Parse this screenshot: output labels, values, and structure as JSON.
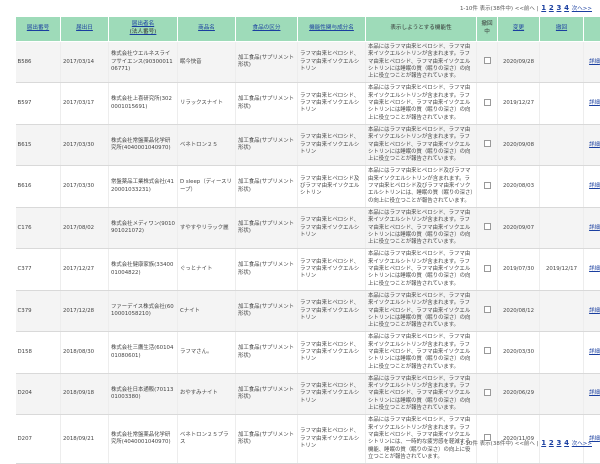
{
  "pager": {
    "summary": "1-10件 表示(38件中) <<前へ |",
    "pages": [
      "1",
      "2",
      "3",
      "4"
    ],
    "next": "次へ>>"
  },
  "table": {
    "headers": {
      "id": "届出番号",
      "date": "届出日",
      "company": "届出者名",
      "company_sub": "(法人番号)",
      "product": "商品名",
      "category": "食品の区分",
      "ingredient": "機能性関与成分名",
      "claim": "表示しようとする機能性",
      "withdrawn": "撤回中",
      "change": "変更",
      "withdraw": "撤回"
    },
    "detail_label": "詳細",
    "rows": [
      {
        "id": "B586",
        "date": "2017/03/14",
        "company": "株式会社ウエルネスライフサイエンス(9030001106771)",
        "product": "眠今快音",
        "category": "加工食品(サプリメント形状)",
        "ingredient": "ラフマ由来ヒペロシド、ラフマ由来イソクエルシトリン",
        "claim": "本品にはラフマ由来ヒペロシド、ラフマ由来イソクエルシトリンが含まれます。ラフマ由来ヒペロシド、ラフマ由来イソクエルシトリンには睡眠の質（眠りの深さ）の向上に役立つことが報告されています。",
        "change": "2020/09/28",
        "withdraw": ""
      },
      {
        "id": "B597",
        "date": "2017/03/17",
        "company": "株式会社上喜研究所(3020001015691)",
        "product": "リラックスナイト",
        "category": "加工食品(サプリメント形状)",
        "ingredient": "ラフマ由来ヒペロシド、ラフマ由来イソクエルシトリン",
        "claim": "本品にはラフマ由来ヒペロシド、ラフマ由来イソクエルシトリンが含まれます。ラフマ由来ヒペロシド、ラフマ由来イソクエルシトリンには睡眠の質（眠りの深さ）の向上に役立つことが報告されています。",
        "change": "2019/12/27",
        "withdraw": ""
      },
      {
        "id": "B615",
        "date": "2017/03/30",
        "company": "株式会社常盤薬品化学研究所(4040001040970)",
        "product": "ベネトロン２５",
        "category": "加工食品(サプリメント形状)",
        "ingredient": "ラフマ由来ヒペロシド、ラフマ由来イソクエルシトリン",
        "claim": "本品にはラフマ由来ヒペロシド、ラフマ由来イソクエルシトリンが含まれます。ラフマ由来ヒペロシド、ラフマ由来イソクエルシトリンには睡眠の質（眠りの深さ）の向上に役立つことが報告されています。",
        "change": "2020/09/08",
        "withdraw": ""
      },
      {
        "id": "B616",
        "date": "2017/03/30",
        "company": "常盤薬品工業株式会社(4120001033231)",
        "product": "D sleep（ディースリープ）",
        "category": "加工食品(サプリメント形状)",
        "ingredient": "ラフマ由来ヒペロシド及びラフマ由来イソクエルシトリン",
        "claim": "本品にはラフマ由来ヒペロシド及びラフマ由来イソクエルシトリンが含まれます。ラフマ由来ヒペロシド及びラフマ由来イソクエルシトリンには、睡眠の質（眠りの深さ）の向上に役立つことが報告されています。",
        "change": "2020/08/03",
        "withdraw": ""
      },
      {
        "id": "C176",
        "date": "2017/08/02",
        "company": "株式会社メディワン(9010901021072)",
        "product": "すやすやリラック麗",
        "category": "加工食品(サプリメント形状)",
        "ingredient": "ラフマ由来ヒペロシド、ラフマ由来イソクエルシトリン",
        "claim": "本品にはラフマ由来ヒペロシド、ラフマ由来イソクエルシトリンが含まれます。ラフマ由来ヒペロシド、ラフマ由来イソクエルシトリンには睡眠の質（眠りの深さ）の向上に役立つことが報告されています。",
        "change": "2020/09/07",
        "withdraw": ""
      },
      {
        "id": "C377",
        "date": "2017/12/27",
        "company": "株式会社健康家族(3340001004822)",
        "product": "ぐっとナイト",
        "category": "加工食品(サプリメント形状)",
        "ingredient": "ラフマ由来ヒペロシド、ラフマ由来イソクエルシトリン",
        "claim": "本品にはラフマ由来ヒペロシド、ラフマ由来イソクエルシトリンが含まれます。ラフマ由来ヒペロシド、ラフマ由来イソクエルシトリンには睡眠の質（眠りの深さ）の向上に役立つことが報告されています。",
        "change": "2019/07/30",
        "withdraw": "2019/12/17"
      },
      {
        "id": "C379",
        "date": "2017/12/28",
        "company": "ファーデイス株式会社(6010001058210)",
        "product": "Cナイト",
        "category": "加工食品(サプリメント形状)",
        "ingredient": "ラフマ由来ヒペロシド、ラフマ由来イソクエルシトリン",
        "claim": "本品にはラフマ由来ヒペロシド、ラフマ由来イソクエルシトリンが含まれます。ラフマ由来ヒペロシド、ラフマ由来イソクエルシトリンには睡眠の質（眠りの深さ）の向上に役立つことが報告されています。",
        "change": "2020/08/12",
        "withdraw": ""
      },
      {
        "id": "D158",
        "date": "2018/08/30",
        "company": "株式会社三鷹生活(6010401080601)",
        "product": "ラフマさん。",
        "category": "加工食品(サプリメント形状)",
        "ingredient": "ラフマ由来ヒペロシド、ラフマ由来イソクエルシトリン",
        "claim": "本品にはラフマ由来ヒペロシド、ラフマ由来イソクエルシトリンが含まれます。ラフマ由来ヒペロシド、ラフマ由来イソクエルシトリンには睡眠の質（眠りの深さ）の向上に役立つことが報告されています。",
        "change": "2020/03/30",
        "withdraw": ""
      },
      {
        "id": "D204",
        "date": "2018/09/18",
        "company": "株式会社日本通販(7011301003380)",
        "product": "おやすみナイト",
        "category": "加工食品(サプリメント形状)",
        "ingredient": "ラフマ由来ヒペロシド、ラフマ由来イソクエルシトリン",
        "claim": "本品にはラフマ由来ヒペロシド、ラフマ由来イソクエルシトリンが含まれます。ラフマ由来ヒペロシド、ラフマ由来イソクエルシトリンには睡眠の質（眠りの深さ）の向上に役立つことが報告されています。",
        "change": "2020/06/29",
        "withdraw": ""
      },
      {
        "id": "D207",
        "date": "2018/09/21",
        "company": "株式会社常盤薬品化学研究所(4040001040970)",
        "product": "ベネトロン２５プラス",
        "category": "加工食品(サプリメント形状)",
        "ingredient": "ラフマ由来ヒペロシド、ラフマ由来イソクエルシトリン",
        "claim": "本品にはラフマ由来ヒペロシド、ラフマ由来イソクエルシトリンが含まれます。ラフマ由来ヒペロシド、ラフマ由来イソクエルシトリンには、一時的な疲労感を軽減する機能、睡眠の質（眠りの深さ）の向上に役立つことが報告されています。",
        "change": "2020/11/09",
        "withdraw": ""
      }
    ]
  }
}
